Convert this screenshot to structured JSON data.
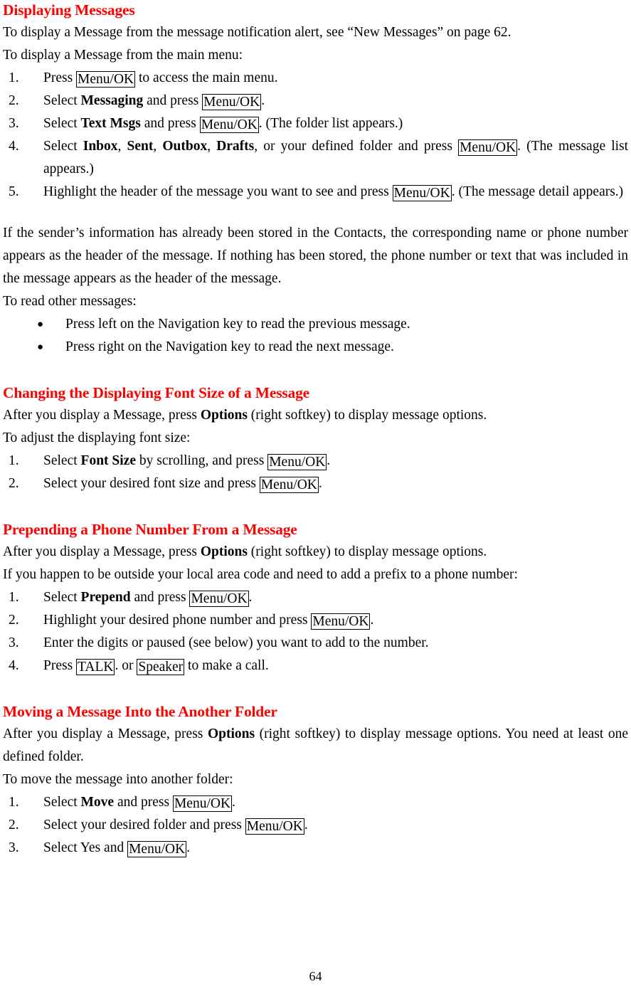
{
  "document": {
    "page_number": "64",
    "heading_color": "#ff0000",
    "body_color": "#000000"
  },
  "sections": [
    {
      "id": "displaying-messages",
      "heading": "Displaying Messages",
      "intro_1": "To display a Message from the message notification alert, see “New Messages” on page 62.",
      "intro_2": "To display a Message from the main menu:",
      "steps": [
        {
          "num": "1.",
          "pre": "Press ",
          "key1": "Menu/OK",
          "post": " to access the main menu."
        },
        {
          "num": "2.",
          "pre": "Select ",
          "bold1": "Messaging",
          "mid": " and press ",
          "key1": "Menu/OK",
          "post": "."
        },
        {
          "num": "3.",
          "pre": "Select ",
          "bold1": "Text Msgs",
          "mid": " and press ",
          "key1": "Menu/OK",
          "post": ". (The folder list appears.)"
        },
        {
          "num": "4.",
          "pre": "Select ",
          "bold1": "Inbox",
          "sep1": ", ",
          "bold2": "Sent",
          "sep2": ", ",
          "bold3": "Outbox",
          "sep3": ", ",
          "bold4": "Drafts",
          "mid": ", or your defined folder and press ",
          "key1": "Menu/OK",
          "post": ". (The message list appears.)"
        },
        {
          "num": "5.",
          "pre": "Highlight the header of the message you want to see and press ",
          "key1": "Menu/OK",
          "post": ". (The message detail appears.)"
        }
      ],
      "note_para": "If the sender’s information has already been stored in the Contacts, the corresponding name or phone number appears as the header of the message. If nothing has been stored, the phone number or text that was included in the message appears as the header of the message.",
      "read_other_lead": "To read other messages:",
      "bullets": [
        {
          "glyph": "●",
          "text": "Press left on the Navigation key to read the previous message."
        },
        {
          "glyph": "●",
          "text": "Press right on the Navigation key to read the next message."
        }
      ]
    },
    {
      "id": "changing-font-size",
      "heading": "Changing the Displaying Font Size of a Message",
      "intro_1_pre": "After you display a Message, press ",
      "intro_1_bold": "Options",
      "intro_1_post": " (right softkey) to display message options.",
      "intro_2": "To adjust the displaying font size:",
      "steps": [
        {
          "num": "1.",
          "pre": "Select ",
          "bold1": "Font Size",
          "mid": " by scrolling, and press ",
          "key1": "Menu/OK",
          "post": "."
        },
        {
          "num": "2.",
          "pre": "Select your desired font size and press ",
          "key1": "Menu/OK",
          "post": "."
        }
      ]
    },
    {
      "id": "prepending-phone-number",
      "heading": "Prepending a Phone Number From a Message",
      "intro_1_pre": "After you display a Message, press ",
      "intro_1_bold": "Options",
      "intro_1_post": " (right softkey) to display message options.",
      "intro_2": "If you happen to be outside your local area code and need to add a prefix to a phone number:",
      "steps": [
        {
          "num": "1.",
          "pre": "Select ",
          "bold1": "Prepend",
          "mid": " and press ",
          "key1": "Menu/OK",
          "post": "."
        },
        {
          "num": "2.",
          "pre": "Highlight your desired phone number and press ",
          "key1": "Menu/OK",
          "post": "."
        },
        {
          "num": "3.",
          "pre": "Enter the digits or paused (see below) you want to add to the number.",
          "key1": "",
          "post": ""
        },
        {
          "num": "4.",
          "pre": "Press ",
          "key1": "TALK",
          "mid2": ". or ",
          "key2": "Speaker",
          "post": " to make a call."
        }
      ]
    },
    {
      "id": "moving-message",
      "heading": "Moving a Message Into the Another Folder",
      "intro_1_pre": "After you display a Message, press ",
      "intro_1_bold": "Options",
      "intro_1_post": " (right softkey) to display message options. You need at least one defined folder.",
      "intro_2": "To move the message into another folder:",
      "steps": [
        {
          "num": "1.",
          "pre": "Select ",
          "bold1": "Move",
          "mid": " and press ",
          "key1": "Menu/OK",
          "post": "."
        },
        {
          "num": "2.",
          "pre": "Select your desired folder and press ",
          "key1": "Menu/OK",
          "post": "."
        },
        {
          "num": "3.",
          "pre": "Select Yes and ",
          "key1": "Menu/OK",
          "post": "."
        }
      ]
    }
  ]
}
